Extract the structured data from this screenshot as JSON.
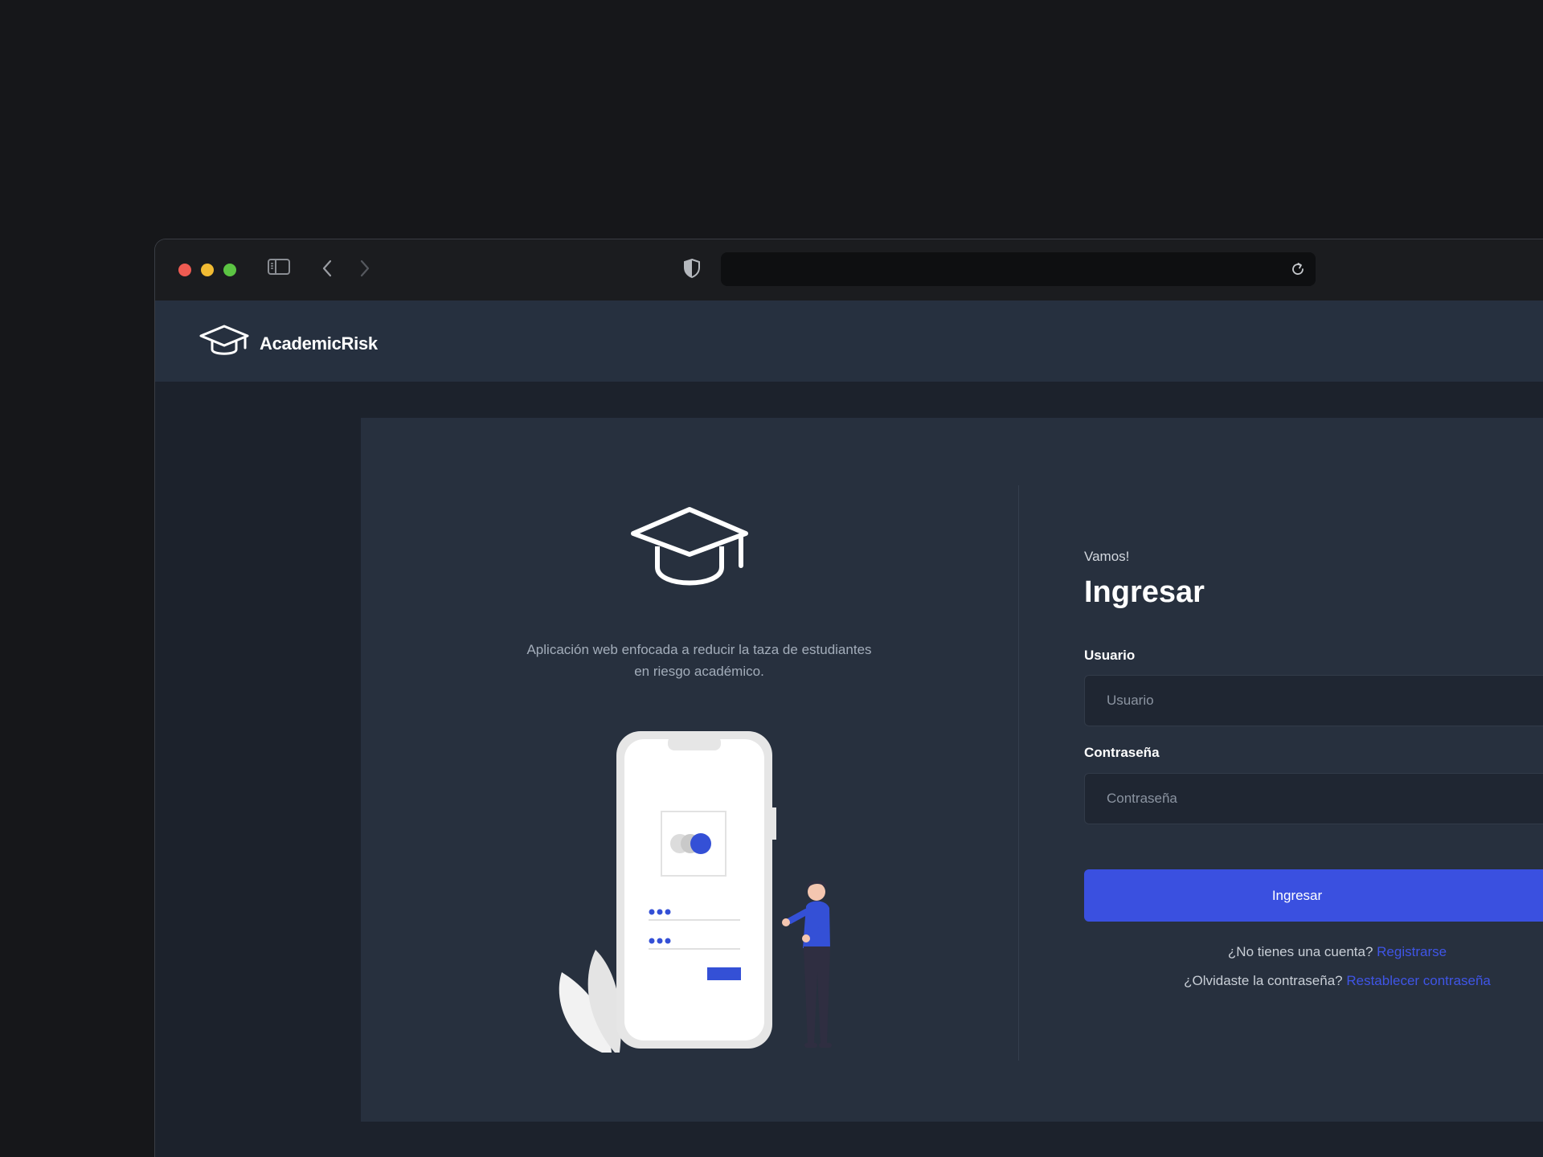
{
  "browser": {
    "url": ""
  },
  "app": {
    "brand": "AcademicRisk"
  },
  "hero": {
    "description": "Aplicación web enfocada a reducir la taza de estudiantes en riesgo académico."
  },
  "login": {
    "eyebrow": "Vamos!",
    "title": "Ingresar",
    "username_label": "Usuario",
    "username_placeholder": "Usuario",
    "password_label": "Contraseña",
    "password_placeholder": "Contraseña",
    "submit_label": "Ingresar",
    "register_prompt": "¿No tienes una cuenta?",
    "register_link": "Registrarse",
    "forgot_prompt": "¿Olvidaste la contraseña?",
    "forgot_link": "Restablecer contraseña"
  },
  "colors": {
    "accent": "#3a50e0",
    "card": "#27303e",
    "appbar": "#26303f"
  },
  "icons": [
    "graduation-cap-icon",
    "sidebar-icon",
    "back-icon",
    "forward-icon",
    "shield-icon",
    "reload-icon"
  ]
}
